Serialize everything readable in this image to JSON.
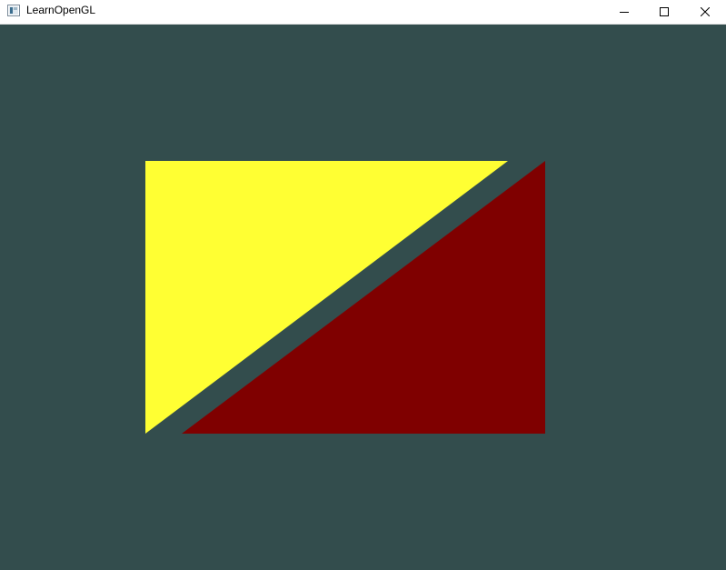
{
  "window": {
    "title": "LearnOpenGL",
    "app_icon": "app-icon",
    "controls": {
      "minimize_icon": "minimize-icon",
      "maximize_icon": "maximize-icon",
      "close_icon": "close-icon"
    }
  },
  "scene": {
    "clear_color": "#334d4d",
    "shapes": [
      {
        "name": "yellow-triangle",
        "color": "#ffff33"
      },
      {
        "name": "dark-red-triangle",
        "color": "#7f0000"
      }
    ]
  }
}
